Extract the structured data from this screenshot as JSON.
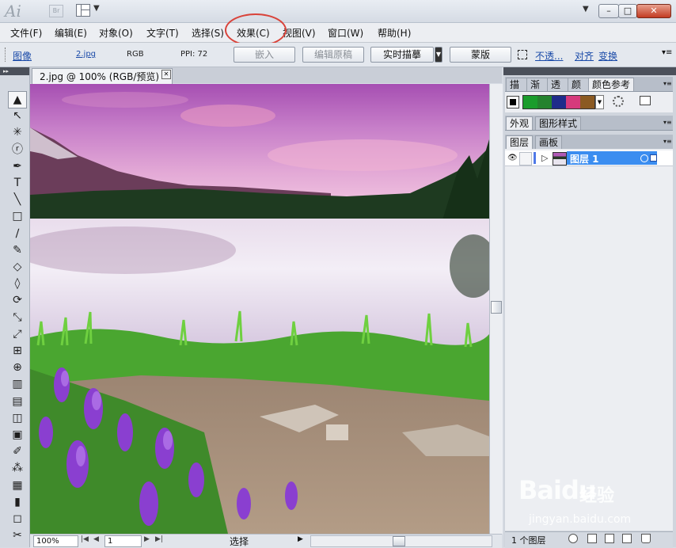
{
  "titlebar": {
    "app_logo": "Ai",
    "bridge_label": "Br",
    "min_label": "–",
    "max_label": "□",
    "close_label": "✕",
    "caret": "▼"
  },
  "menu": {
    "items": [
      "文件(F)",
      "编辑(E)",
      "对象(O)",
      "文字(T)",
      "选择(S)",
      "效果(C)",
      "视图(V)",
      "窗口(W)",
      "帮助(H)"
    ]
  },
  "control": {
    "image_label": "图像",
    "file_name": "2.jpg",
    "color_mode": "RGB",
    "ppi": "PPI: 72",
    "embed": "嵌入",
    "edit_original": "编辑原稿",
    "live_trace": "实时描摹",
    "trace_menu": "▼",
    "mask": "蒙版",
    "opacity": "不透...",
    "align": "对齐",
    "transform": "变换",
    "menu_glyph": "▾≡"
  },
  "document": {
    "tab_title": "2.jpg @ 100% (RGB/预览)",
    "close_glyph": "✕"
  },
  "status": {
    "zoom": "100%",
    "page": "1",
    "label": "选择",
    "arrow": "▶",
    "nav_first": "|◀",
    "nav_prev": "◀",
    "nav_next": "▶",
    "nav_last": "▶|"
  },
  "panels": {
    "group1_tabs": [
      "描边",
      "渐变",
      "透明",
      "颜色",
      "颜色参考"
    ],
    "group2_tabs": [
      "外观",
      "图形样式"
    ],
    "group3_tabs": [
      "图层",
      "画板"
    ],
    "layer_name": "图层 1",
    "layer_count": "1 个图层",
    "swatches": [
      "#1a9c2c",
      "#24822e",
      "#1f2c8a",
      "#d63a7c",
      "#8b5a22"
    ]
  },
  "toolbox": {
    "icons": [
      "▲",
      "↖",
      "✳",
      "ⓡ",
      "✒",
      "T",
      "╲",
      "□",
      "∕",
      "✎",
      "◇",
      "◊",
      "⟳",
      "⤡",
      "⤢",
      "⊞",
      "⊕",
      "▥",
      "▤",
      "◫",
      "▣",
      "✐",
      "⁂",
      "▦",
      "▮",
      "◻",
      "✂"
    ]
  },
  "watermark": {
    "logo": "Bai",
    "paw": "du",
    "text": "经验",
    "url": "jingyan.baidu.com"
  },
  "colors": {
    "accent": "#3b8df0",
    "highlight_circle": "#d9433a"
  }
}
